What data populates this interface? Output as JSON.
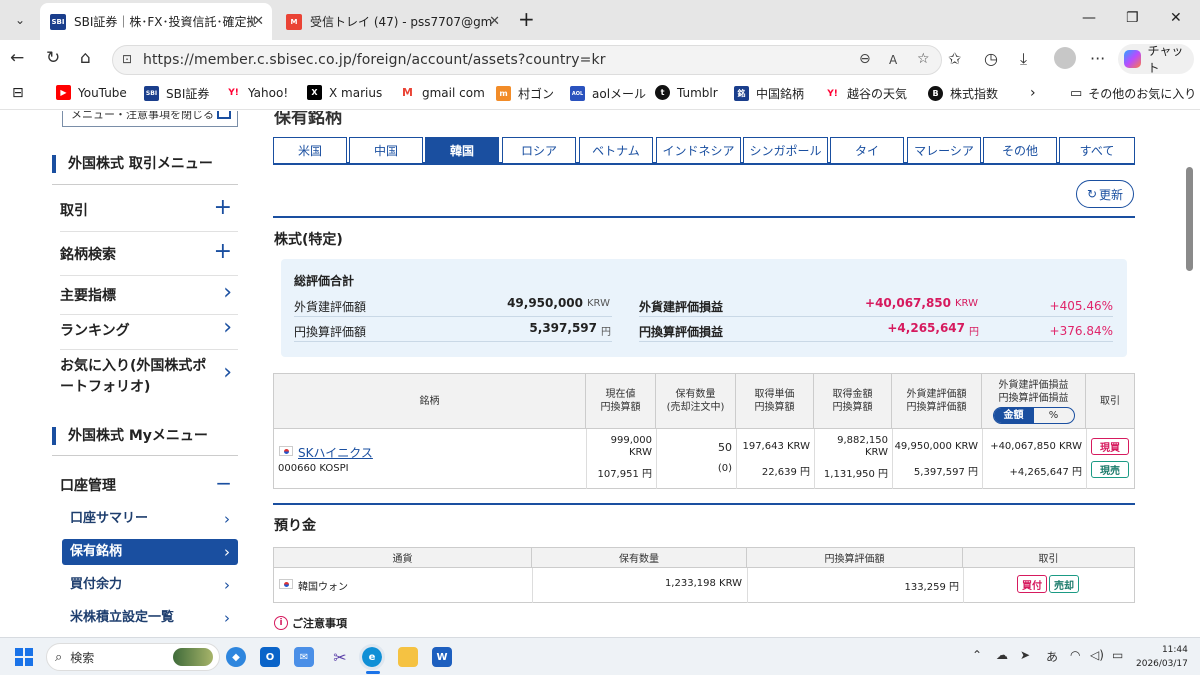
{
  "browser": {
    "tabs": [
      {
        "title": "SBI証券｜株･FX･投資信託･確定拠",
        "favicon": "SBI"
      },
      {
        "title": "受信トレイ (47) - pss7707@gmail.co",
        "favicon": "M"
      }
    ],
    "new_tab": "+",
    "url": "https://member.c.sbisec.co.jp/foreign/account/assets?country=kr",
    "chat_label": "チャット",
    "bookmarks": [
      {
        "label": "YouTube",
        "icon": "youtube-icon",
        "color": "#ff0000",
        "glyph": "▶"
      },
      {
        "label": "SBI証券",
        "icon": "sbi-icon",
        "color": "#1a3e8c",
        "glyph": "SBI"
      },
      {
        "label": "Yahoo!",
        "icon": "yahoo-icon",
        "color": "#ff0033",
        "glyph": "Y!"
      },
      {
        "label": "X marius",
        "icon": "x-icon",
        "color": "#000000",
        "glyph": "X"
      },
      {
        "label": "gmail com",
        "icon": "gmail-icon",
        "color": "#ea4335",
        "glyph": "M"
      },
      {
        "label": "村ゴン",
        "icon": "muragon-icon",
        "color": "#f28c28",
        "glyph": "m"
      },
      {
        "label": "aolメール",
        "icon": "aol-icon",
        "color": "#2a52be",
        "glyph": "AOL"
      },
      {
        "label": "Tumblr",
        "icon": "tumblr-icon",
        "color": "#111111",
        "glyph": "t"
      },
      {
        "label": "中国銘柄",
        "icon": "china-stock-icon",
        "color": "#1a3e8c",
        "glyph": "銘"
      },
      {
        "label": "越谷の天気",
        "icon": "yahoo-weather-icon",
        "color": "#ff0033",
        "glyph": "Y!"
      },
      {
        "label": "株式指数",
        "icon": "b-icon",
        "color": "#111111",
        "glyph": "B"
      }
    ],
    "other_favorites": "その他のお気に入り"
  },
  "sidebar": {
    "menu_close": "メニュー・注意事項を閉じる",
    "trade_menu_title": "外国株式 取引メニュー",
    "trade_items": [
      {
        "label": "取引",
        "icon": "plus-icon",
        "glyph": "+"
      },
      {
        "label": "銘柄検索",
        "icon": "plus-icon",
        "glyph": "+"
      },
      {
        "label": "主要指標",
        "icon": "chevron-right-icon",
        "glyph": "›"
      },
      {
        "label": "ランキング",
        "icon": "chevron-right-icon",
        "glyph": "›"
      },
      {
        "label": "お気に入り(外国株式ポートフォリオ)",
        "icon": "chevron-right-icon",
        "glyph": "›"
      }
    ],
    "my_menu_title": "外国株式 Myメニュー",
    "account_label": "口座管理",
    "account_icon": "minus-icon",
    "account_glyph": "−",
    "account_sub": [
      {
        "label": "口座サマリー",
        "selected": false
      },
      {
        "label": "保有銘柄",
        "selected": true
      },
      {
        "label": "買付余力",
        "selected": false
      },
      {
        "label": "米株積立設定一覧",
        "selected": false
      }
    ]
  },
  "main": {
    "title": "保有銘柄",
    "country_tabs": [
      "米国",
      "中国",
      "韓国",
      "ロシア",
      "ベトナム",
      "インドネシア",
      "シンガポール",
      "タイ",
      "マレーシア",
      "その他",
      "すべて"
    ],
    "active_tab": "韓国",
    "refresh": "更新",
    "section_title": "株式(特定)",
    "summary": {
      "title": "総評価合計",
      "rows": [
        {
          "label": "外貨建評価額",
          "value": "49,950,000",
          "unit": "KRW"
        },
        {
          "label": "円換算評価額",
          "value": "5,397,597",
          "unit": "円"
        }
      ],
      "pl_rows": [
        {
          "label": "外貨建評価損益",
          "value": "+40,067,850",
          "unit": "KRW",
          "pct": "+405.46%"
        },
        {
          "label": "円換算評価損益",
          "value": "+4,265,647",
          "unit": "円",
          "pct": "+376.84%"
        }
      ]
    },
    "holdings": {
      "headers": [
        {
          "l1": "銘柄",
          "l2": ""
        },
        {
          "l1": "現在値",
          "l2": "円換算額"
        },
        {
          "l1": "保有数量",
          "l2": "(売却注文中)"
        },
        {
          "l1": "取得単価",
          "l2": "円換算額"
        },
        {
          "l1": "取得金額",
          "l2": "円換算額"
        },
        {
          "l1": "外貨建評価額",
          "l2": "円換算評価額"
        },
        {
          "l1": "外貨建評価損益",
          "l2": "円換算評価損益"
        },
        {
          "l1": "取引",
          "l2": ""
        }
      ],
      "toggle": {
        "amount": "金額",
        "percent": "%"
      },
      "rows": [
        {
          "name": "SKハイニクス",
          "code": "000660 KOSPI",
          "price": "999,000",
          "price_unit": "KRW",
          "price_jpy": "107,951 円",
          "qty": "50",
          "qty_pending": "(0)",
          "unit_cost": "197,643 KRW",
          "unit_cost_jpy": "22,639 円",
          "cost": "9,882,150",
          "cost_unit": "KRW",
          "cost_jpy": "1,131,950 円",
          "value": "49,950,000 KRW",
          "value_jpy": "5,397,597 円",
          "pl": "+40,067,850 KRW",
          "pl_jpy": "+4,265,647 円",
          "buy": "現買",
          "sell": "現売"
        }
      ]
    },
    "deposit": {
      "title": "預り金",
      "headers": [
        "通貨",
        "保有数量",
        "円換算評価額",
        "取引"
      ],
      "rows": [
        {
          "currency": "韓国ウォン",
          "qty": "1,233,198 KRW",
          "jpy": "133,259 円",
          "buy": "買付",
          "sell": "売却"
        }
      ]
    },
    "notice": "ご注意事項"
  },
  "taskbar": {
    "search": "検索",
    "ime": "あ",
    "time": "11:44",
    "date": "2026/03/17"
  },
  "colors": {
    "accent": "#1a4fa0",
    "profit": "#d61a5e",
    "summary_bg": "#eaf3fb"
  }
}
